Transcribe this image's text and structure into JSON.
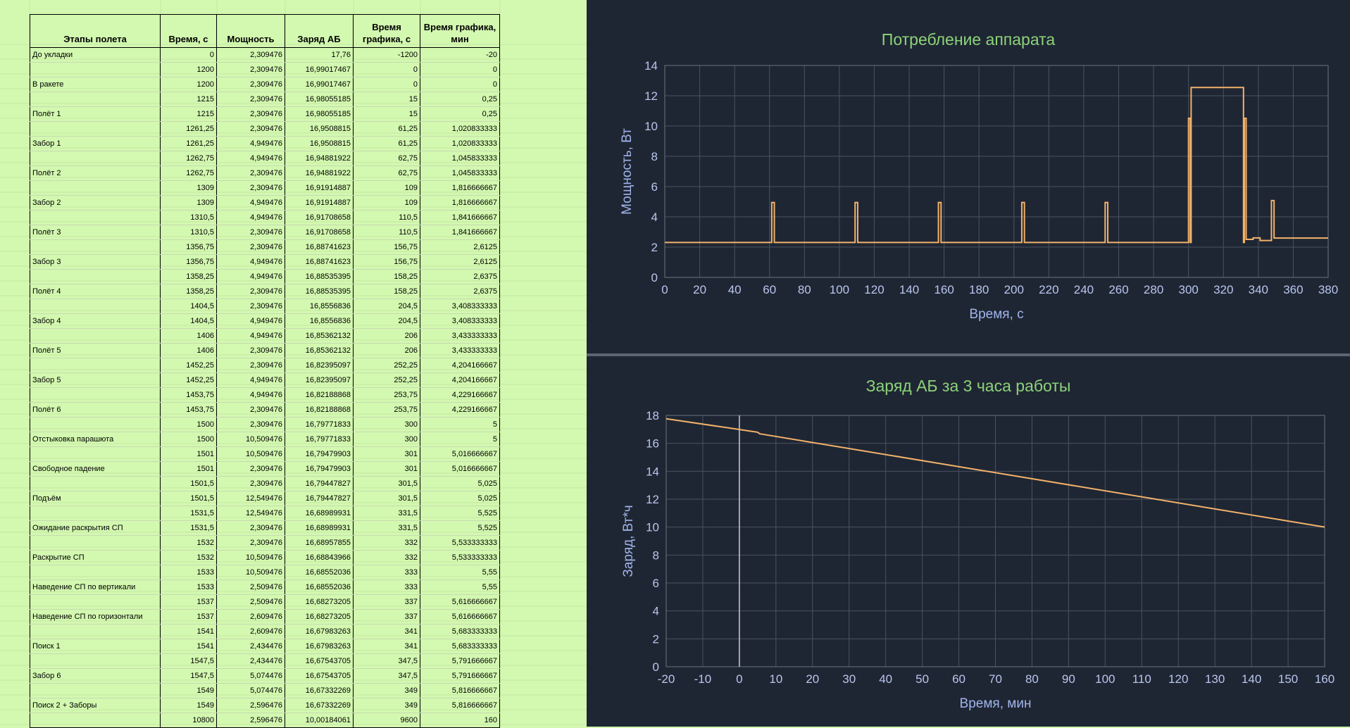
{
  "colors": {
    "sheet_bg": "#d3f8b0",
    "panel_bg": "#1f2633",
    "title": "#8cd37a",
    "axis_text": "#9fb4ea",
    "line": "#f2b26b",
    "grid": "#4a5160"
  },
  "table": {
    "headers": [
      "Этапы полета",
      "Время, с",
      "Мощность",
      "Заряд АБ",
      "Время графика, с",
      "Время графика, мин"
    ],
    "rows": [
      [
        "До укладки",
        "0",
        "2,309476",
        "17,76",
        "-1200",
        "-20"
      ],
      [
        "",
        "1200",
        "2,309476",
        "16,99017467",
        "0",
        "0"
      ],
      [
        "В ракете",
        "1200",
        "2,309476",
        "16,99017467",
        "0",
        "0"
      ],
      [
        "",
        "1215",
        "2,309476",
        "16,98055185",
        "15",
        "0,25"
      ],
      [
        "Полёт 1",
        "1215",
        "2,309476",
        "16,98055185",
        "15",
        "0,25"
      ],
      [
        "",
        "1261,25",
        "2,309476",
        "16,9508815",
        "61,25",
        "1,020833333"
      ],
      [
        "Забор 1",
        "1261,25",
        "4,949476",
        "16,9508815",
        "61,25",
        "1,020833333"
      ],
      [
        "",
        "1262,75",
        "4,949476",
        "16,94881922",
        "62,75",
        "1,045833333"
      ],
      [
        "Полёт 2",
        "1262,75",
        "2,309476",
        "16,94881922",
        "62,75",
        "1,045833333"
      ],
      [
        "",
        "1309",
        "2,309476",
        "16,91914887",
        "109",
        "1,816666667"
      ],
      [
        "Забор 2",
        "1309",
        "4,949476",
        "16,91914887",
        "109",
        "1,816666667"
      ],
      [
        "",
        "1310,5",
        "4,949476",
        "16,91708658",
        "110,5",
        "1,841666667"
      ],
      [
        "Полёт 3",
        "1310,5",
        "2,309476",
        "16,91708658",
        "110,5",
        "1,841666667"
      ],
      [
        "",
        "1356,75",
        "2,309476",
        "16,88741623",
        "156,75",
        "2,6125"
      ],
      [
        "Забор 3",
        "1356,75",
        "4,949476",
        "16,88741623",
        "156,75",
        "2,6125"
      ],
      [
        "",
        "1358,25",
        "4,949476",
        "16,88535395",
        "158,25",
        "2,6375"
      ],
      [
        "Полёт 4",
        "1358,25",
        "2,309476",
        "16,88535395",
        "158,25",
        "2,6375"
      ],
      [
        "",
        "1404,5",
        "2,309476",
        "16,8556836",
        "204,5",
        "3,408333333"
      ],
      [
        "Забор 4",
        "1404,5",
        "4,949476",
        "16,8556836",
        "204,5",
        "3,408333333"
      ],
      [
        "",
        "1406",
        "4,949476",
        "16,85362132",
        "206",
        "3,433333333"
      ],
      [
        "Полёт 5",
        "1406",
        "2,309476",
        "16,85362132",
        "206",
        "3,433333333"
      ],
      [
        "",
        "1452,25",
        "2,309476",
        "16,82395097",
        "252,25",
        "4,204166667"
      ],
      [
        "Забор 5",
        "1452,25",
        "4,949476",
        "16,82395097",
        "252,25",
        "4,204166667"
      ],
      [
        "",
        "1453,75",
        "4,949476",
        "16,82188868",
        "253,75",
        "4,229166667"
      ],
      [
        "Полёт 6",
        "1453,75",
        "2,309476",
        "16,82188868",
        "253,75",
        "4,229166667"
      ],
      [
        "",
        "1500",
        "2,309476",
        "16,79771833",
        "300",
        "5"
      ],
      [
        "Отстыковка парашюта",
        "1500",
        "10,509476",
        "16,79771833",
        "300",
        "5"
      ],
      [
        "",
        "1501",
        "10,509476",
        "16,79479903",
        "301",
        "5,016666667"
      ],
      [
        "Свободное падение",
        "1501",
        "2,309476",
        "16,79479903",
        "301",
        "5,016666667"
      ],
      [
        "",
        "1501,5",
        "2,309476",
        "16,79447827",
        "301,5",
        "5,025"
      ],
      [
        "Подъём",
        "1501,5",
        "12,549476",
        "16,79447827",
        "301,5",
        "5,025"
      ],
      [
        "",
        "1531,5",
        "12,549476",
        "16,68989931",
        "331,5",
        "5,525"
      ],
      [
        "Ожидание раскрытия СП",
        "1531,5",
        "2,309476",
        "16,68989931",
        "331,5",
        "5,525"
      ],
      [
        "",
        "1532",
        "2,309476",
        "16,68957855",
        "332",
        "5,533333333"
      ],
      [
        "Раскрытие СП",
        "1532",
        "10,509476",
        "16,68843966",
        "332",
        "5,533333333"
      ],
      [
        "",
        "1533",
        "10,509476",
        "16,68552036",
        "333",
        "5,55"
      ],
      [
        "Наведение СП по вертикали",
        "1533",
        "2,509476",
        "16,68552036",
        "333",
        "5,55"
      ],
      [
        "",
        "1537",
        "2,509476",
        "16,68273205",
        "337",
        "5,616666667"
      ],
      [
        "Наведение СП по горизонтали",
        "1537",
        "2,609476",
        "16,68273205",
        "337",
        "5,616666667"
      ],
      [
        "",
        "1541",
        "2,609476",
        "16,67983263",
        "341",
        "5,683333333"
      ],
      [
        "Поиск 1",
        "1541",
        "2,434476",
        "16,67983263",
        "341",
        "5,683333333"
      ],
      [
        "",
        "1547,5",
        "2,434476",
        "16,67543705",
        "347,5",
        "5,791666667"
      ],
      [
        "Забор 6",
        "1547,5",
        "5,074476",
        "16,67543705",
        "347,5",
        "5,791666667"
      ],
      [
        "",
        "1549",
        "5,074476",
        "16,67332269",
        "349",
        "5,816666667"
      ],
      [
        "Поиск 2 + Заборы",
        "1549",
        "2,596476",
        "16,67332269",
        "349",
        "5,816666667"
      ],
      [
        "",
        "10800",
        "2,596476",
        "10,00184061",
        "9600",
        "160"
      ]
    ]
  },
  "chart_data": [
    {
      "type": "line",
      "title": "Потребление аппарата",
      "xlabel": "Время, с",
      "ylabel": "Мощность, Вт",
      "xlim": [
        0,
        380
      ],
      "ylim": [
        0,
        14
      ],
      "xticks": [
        0,
        20,
        40,
        60,
        80,
        100,
        120,
        140,
        160,
        180,
        200,
        220,
        240,
        260,
        280,
        300,
        320,
        340,
        360,
        380
      ],
      "yticks": [
        0,
        2,
        4,
        6,
        8,
        10,
        12,
        14
      ],
      "grid": true,
      "x": [
        0,
        15,
        15,
        61.25,
        61.25,
        62.75,
        62.75,
        109,
        109,
        110.5,
        110.5,
        156.75,
        156.75,
        158.25,
        158.25,
        204.5,
        204.5,
        206,
        206,
        252.25,
        252.25,
        253.75,
        253.75,
        300,
        300,
        301,
        301,
        301.5,
        301.5,
        331.5,
        331.5,
        332,
        332,
        333,
        333,
        337,
        337,
        341,
        341,
        347.5,
        347.5,
        349,
        349,
        380
      ],
      "y": [
        2.309476,
        2.309476,
        2.309476,
        2.309476,
        4.949476,
        4.949476,
        2.309476,
        2.309476,
        4.949476,
        4.949476,
        2.309476,
        2.309476,
        4.949476,
        4.949476,
        2.309476,
        2.309476,
        4.949476,
        4.949476,
        2.309476,
        2.309476,
        4.949476,
        4.949476,
        2.309476,
        2.309476,
        10.509476,
        10.509476,
        2.309476,
        2.309476,
        12.549476,
        12.549476,
        2.309476,
        2.309476,
        10.509476,
        10.509476,
        2.509476,
        2.509476,
        2.609476,
        2.609476,
        2.434476,
        2.434476,
        5.074476,
        5.074476,
        2.596476,
        2.596476
      ]
    },
    {
      "type": "line",
      "title": "Заряд АБ за 3 часа работы",
      "xlabel": "Время, мин",
      "ylabel": "Заряд, Вт*ч",
      "xlim": [
        -20,
        160
      ],
      "ylim": [
        0,
        18
      ],
      "xticks": [
        -20,
        -10,
        0,
        10,
        20,
        30,
        40,
        50,
        60,
        70,
        80,
        90,
        100,
        110,
        120,
        130,
        140,
        150,
        160
      ],
      "yticks": [
        0,
        2,
        4,
        6,
        8,
        10,
        12,
        14,
        16,
        18
      ],
      "grid": true,
      "x": [
        -20,
        0,
        0.25,
        5.025,
        5.525,
        5.816666667,
        160
      ],
      "y": [
        17.76,
        16.99017467,
        16.98055185,
        16.79447827,
        16.68989931,
        16.67332269,
        10.00184061
      ]
    }
  ]
}
